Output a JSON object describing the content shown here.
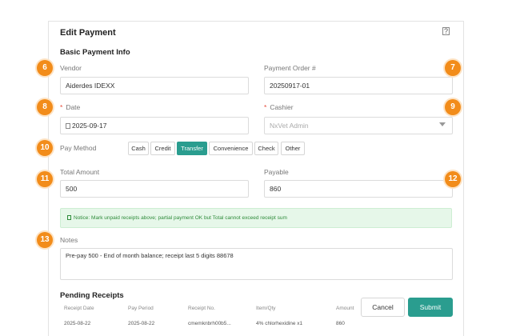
{
  "header": {
    "title": "Edit Payment",
    "help_glyph": "?"
  },
  "section_basic": "Basic Payment Info",
  "badges": [
    "6",
    "7",
    "8",
    "9",
    "10",
    "11",
    "12",
    "13"
  ],
  "vendor": {
    "label": "Vendor",
    "value": "Aiderdes IDEXX"
  },
  "payment_order": {
    "label": "Payment Order #",
    "value": "20250917-01"
  },
  "date": {
    "label": "Date",
    "required_mark": "*",
    "value": "2025-09-17",
    "icon": "calendar-icon"
  },
  "cashier": {
    "label": "Cashier",
    "required_mark": "*",
    "placeholder": "NxVet Admin"
  },
  "pay_method": {
    "label": "Pay Method",
    "options": [
      "Cash",
      "Credit",
      "Transfer",
      "Convenience",
      "Check",
      "Other"
    ],
    "selected": "Transfer"
  },
  "total_amount": {
    "label": "Total Amount",
    "value": "500"
  },
  "payable": {
    "label": "Payable",
    "value": "860"
  },
  "notice": "Notice: Mark unpaid receipts above; partial payment OK but Total cannot exceed receipt sum",
  "notes": {
    "label": "Notes",
    "value": "Pre-pay 500 - End of month balance; receipt last 5 digits 88678"
  },
  "pending": {
    "title": "Pending Receipts",
    "columns": [
      "Receipt Date",
      "Pay Period",
      "Receipt No.",
      "Item/Qty",
      "Amount"
    ],
    "rows": [
      {
        "date": "2025-08-22",
        "period": "2025-08-22",
        "no": "cmemknbrh00b5...",
        "item": "4% chlorhexidine x1",
        "amount": "860"
      }
    ]
  },
  "actions": {
    "cancel": "Cancel",
    "submit": "Submit"
  },
  "colors": {
    "accent": "#2a9d8f",
    "badge": "#f28c1a",
    "required": "#e74c3c",
    "notice_bg": "#e6f7e9"
  }
}
